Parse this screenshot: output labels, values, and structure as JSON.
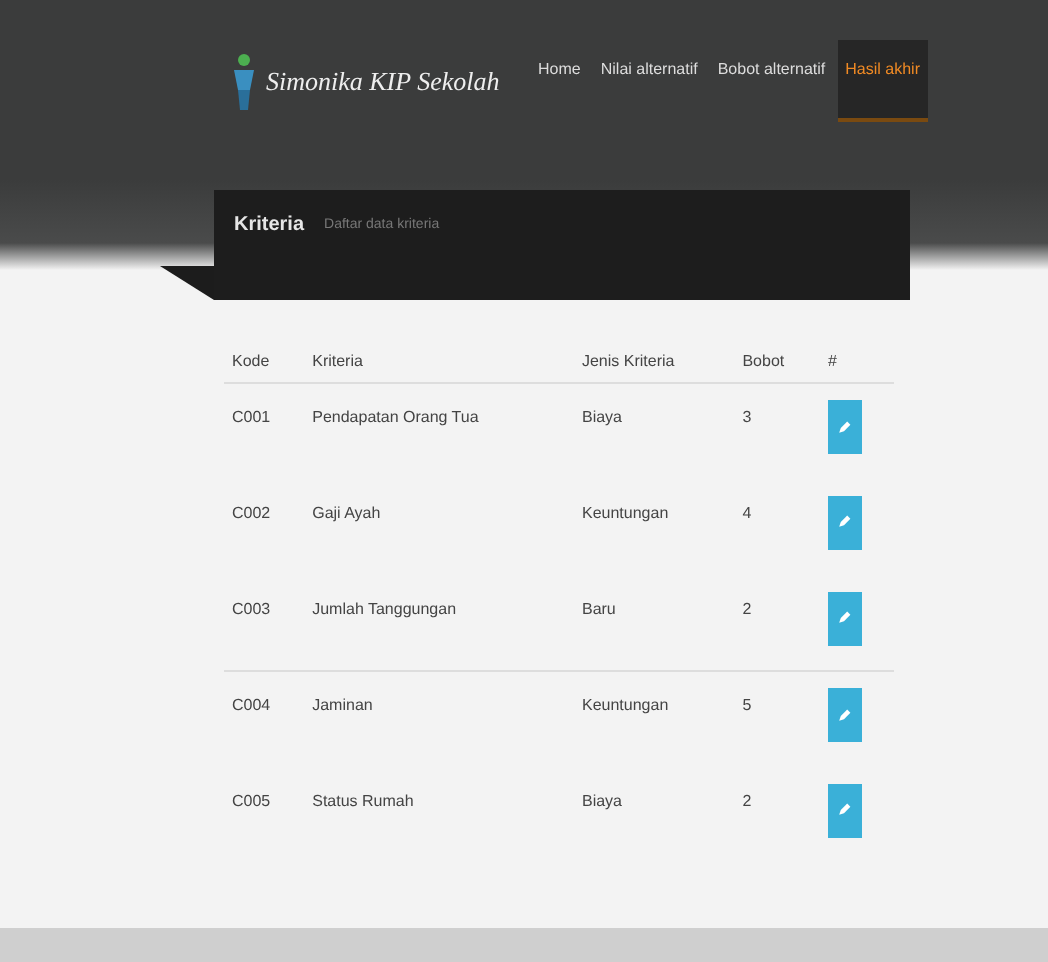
{
  "brand": "Simonika KIP Sekolah",
  "nav": [
    {
      "label": "Home",
      "selected": false
    },
    {
      "label": "Nilai alternatif",
      "selected": false
    },
    {
      "label": "Bobot alternatif",
      "selected": false
    },
    {
      "label": "Hasil akhir",
      "selected": true
    }
  ],
  "panel": {
    "title": "Kriteria",
    "subtitle": "Daftar data kriteria"
  },
  "table": {
    "columns": [
      "Kode",
      "Kriteria",
      "Jenis Kriteria",
      "Bobot",
      "#"
    ],
    "rows": [
      {
        "cells": [
          "C001",
          "Pendapatan Orang Tua",
          "Biaya",
          "3"
        ]
      },
      {
        "cells": [
          "C002",
          "Gaji Ayah",
          "Keuntungan",
          "4"
        ]
      },
      {
        "cells": [
          "C003",
          "Jumlah Tanggungan",
          "Baru",
          "2"
        ]
      },
      {
        "cells": [
          "C004",
          "Jaminan",
          "Keuntungan",
          "5"
        ]
      },
      {
        "cells": [
          "C005",
          "Status Rumah",
          "Biaya",
          "2"
        ]
      }
    ]
  }
}
